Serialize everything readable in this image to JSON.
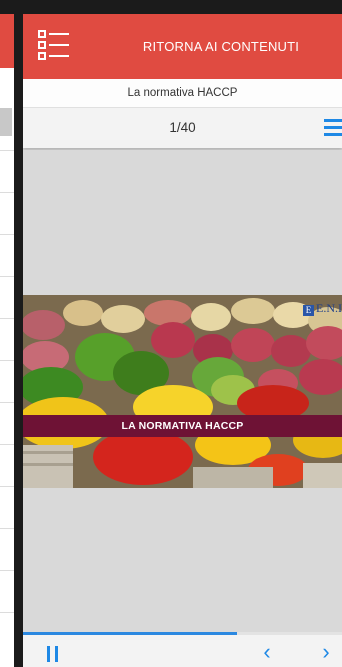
{
  "header": {
    "back_label": "RITORNA AI CONTENUTI",
    "menu_icon": "list-icon",
    "color": "#e04b41"
  },
  "course": {
    "title": "La normativa HACCP"
  },
  "pager": {
    "current": 1,
    "total": 40,
    "label": "1/40",
    "menu_icon": "hamburger-icon"
  },
  "slide": {
    "logo_text": "E.N.I",
    "banner_text": "LA NORMATIVA HACCP",
    "banner_color": "#6e1235"
  },
  "player": {
    "progress_fraction": 0.67,
    "pause_icon": "pause-icon",
    "prev_icon": "chevron-left-icon",
    "next_icon": "chevron-right-icon",
    "accent": "#1e88e5"
  }
}
